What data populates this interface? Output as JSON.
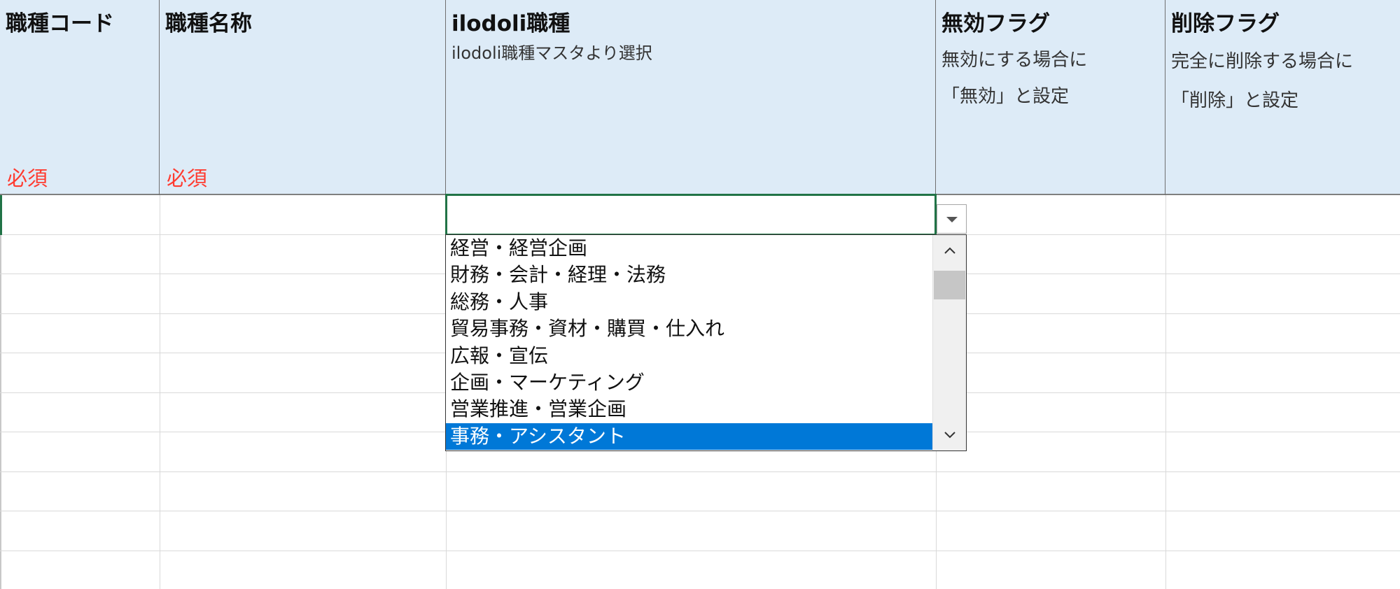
{
  "columns": [
    {
      "title": "職種コード",
      "required": "必須"
    },
    {
      "title": "職種名称",
      "required": "必須"
    },
    {
      "title": "ilodoli職種",
      "desc": "ilodoli職種マスタより選択"
    },
    {
      "title": "無効フラグ",
      "desc_line1": "無効にする場合に",
      "desc_line2": "「無効」と設定"
    },
    {
      "title": "削除フラグ",
      "desc_line1": "完全に削除する場合に",
      "desc_line2": "「削除」と設定"
    }
  ],
  "active_cell": {
    "value": ""
  },
  "dropdown": {
    "items": [
      "経営・経営企画",
      "財務・会計・経理・法務",
      "総務・人事",
      "貿易事務・資材・購買・仕入れ",
      "広報・宣伝",
      "企画・マーケティング",
      "営業推進・営業企画",
      "事務・アシスタント"
    ],
    "selected_index": 7,
    "button_icon": "chevron-down-icon",
    "scroll_up_icon": "chevron-up-icon",
    "scroll_down_icon": "chevron-down-icon"
  },
  "colors": {
    "header_bg": "#ddebf7",
    "required": "#ff3b30",
    "selection": "#0078d7",
    "active_border": "#217346"
  }
}
